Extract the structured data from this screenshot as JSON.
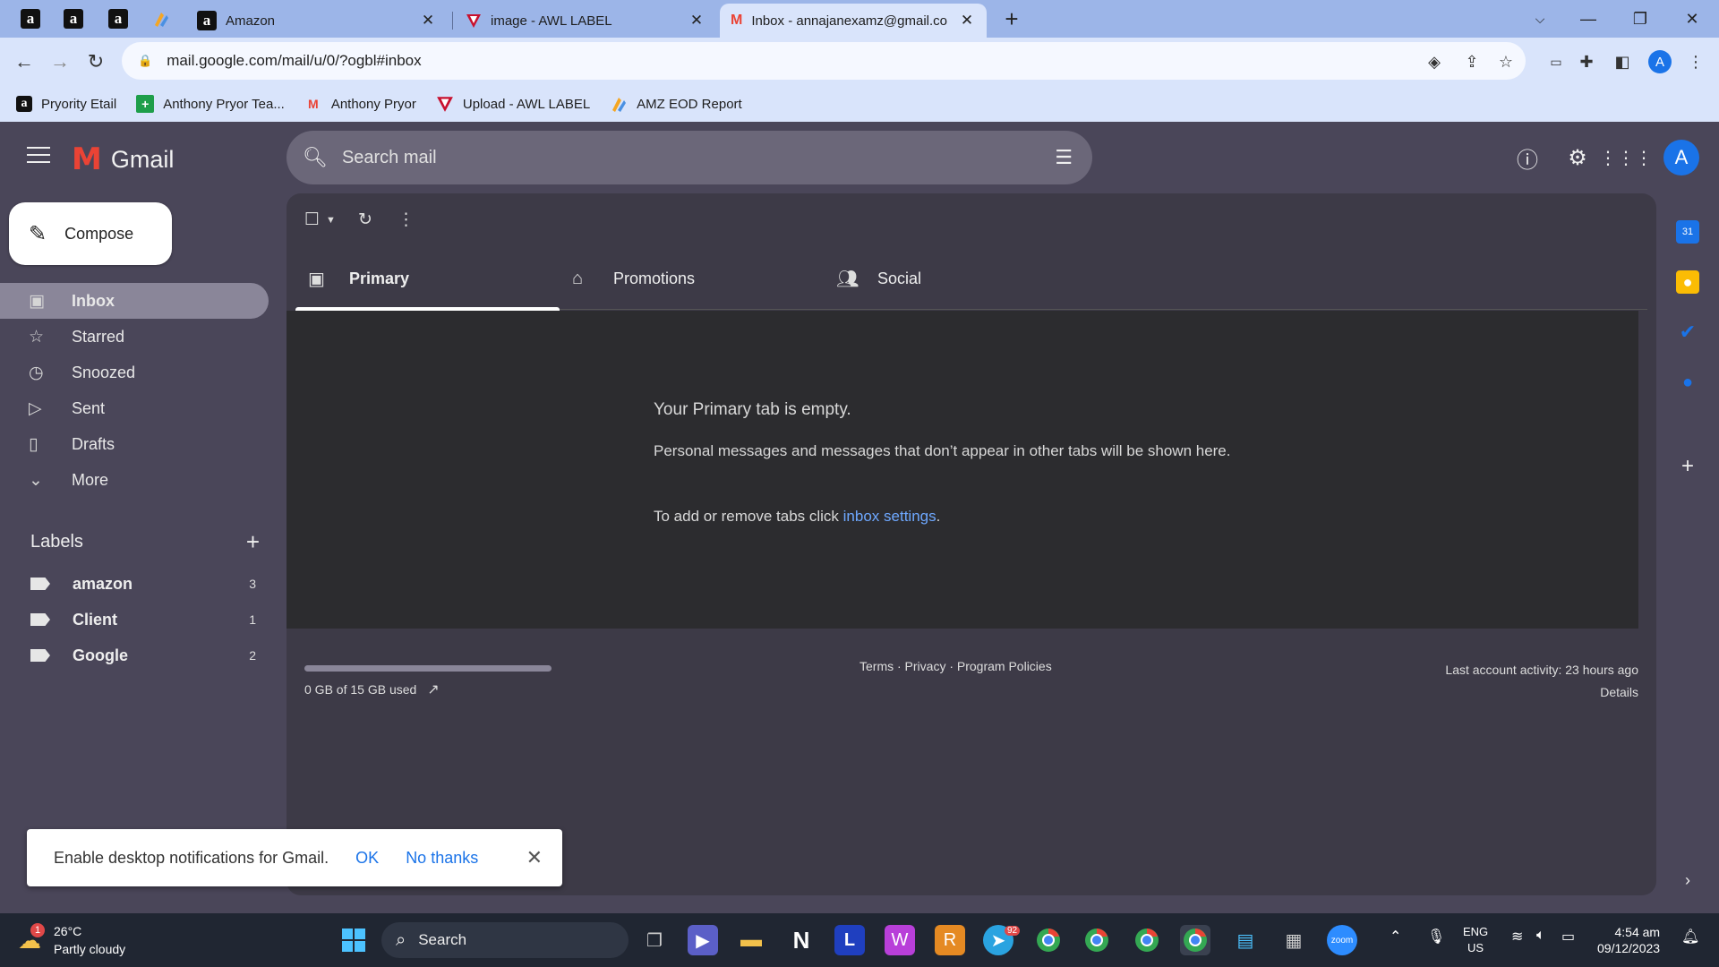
{
  "browser": {
    "pinned_tabs": [
      "amazon-icon",
      "amazon-icon",
      "amazon-icon",
      "amz-eod-icon"
    ],
    "tabs": [
      {
        "title": "Amazon",
        "icon": "amazon-icon"
      },
      {
        "title": "image - AWL LABEL",
        "icon": "awl-icon"
      },
      {
        "title": "Inbox - annajanexamz@gmail.co",
        "icon": "gmail-icon"
      }
    ],
    "new_tab_label": "+",
    "url": "mail.google.com/mail/u/0/?ogbl#inbox",
    "profile_initial": "A",
    "bookmarks": [
      {
        "label": "Pryority Etail",
        "icon": "amazon-icon"
      },
      {
        "label": "Anthony Pryor Tea...",
        "icon": "plus-square-icon"
      },
      {
        "label": "Anthony Pryor",
        "icon": "gmail-icon"
      },
      {
        "label": "Upload - AWL LABEL",
        "icon": "awl-icon"
      },
      {
        "label": "AMZ EOD Report",
        "icon": "amz-eod-icon"
      }
    ]
  },
  "gmail": {
    "logo_text": "Gmail",
    "search_placeholder": "Search mail",
    "avatar_initial": "A",
    "compose_label": "Compose",
    "nav": [
      {
        "label": "Inbox",
        "icon": "inbox-icon",
        "active": true
      },
      {
        "label": "Starred",
        "icon": "star-icon"
      },
      {
        "label": "Snoozed",
        "icon": "clock-icon"
      },
      {
        "label": "Sent",
        "icon": "send-icon"
      },
      {
        "label": "Drafts",
        "icon": "draft-icon"
      },
      {
        "label": "More",
        "icon": "chevron-down-icon"
      }
    ],
    "labels_title": "Labels",
    "labels": [
      {
        "name": "amazon",
        "count": "3"
      },
      {
        "name": "Client",
        "count": "1"
      },
      {
        "name": "Google",
        "count": "2"
      }
    ],
    "tabs": [
      {
        "label": "Primary",
        "icon": "inbox-tab-icon",
        "active": true
      },
      {
        "label": "Promotions",
        "icon": "tag-icon"
      },
      {
        "label": "Social",
        "icon": "people-icon"
      }
    ],
    "empty": {
      "title": "Your Primary tab is empty.",
      "body": "Personal messages and messages that don’t appear in other tabs will be shown here.",
      "tabs_prefix": "To add or remove tabs click ",
      "tabs_link": "inbox settings",
      "tabs_suffix": "."
    },
    "storage": {
      "text": "0 GB of 15 GB used",
      "fraction_used": 0.0
    },
    "policies": "Terms · Privacy · Program Policies",
    "activity": {
      "line1": "Last account activity: 23 hours ago",
      "line2": "Details"
    },
    "notification": {
      "text": "Enable desktop notifications for Gmail.",
      "ok": "OK",
      "no": "No thanks"
    }
  },
  "taskbar": {
    "weather_badge": "1",
    "temperature": "26°C",
    "condition": "Partly cloudy",
    "search_label": "Search",
    "telegram_badge": "92",
    "lang1": "ENG",
    "lang2": "US",
    "time": "4:54 am",
    "date": "09/12/2023"
  }
}
